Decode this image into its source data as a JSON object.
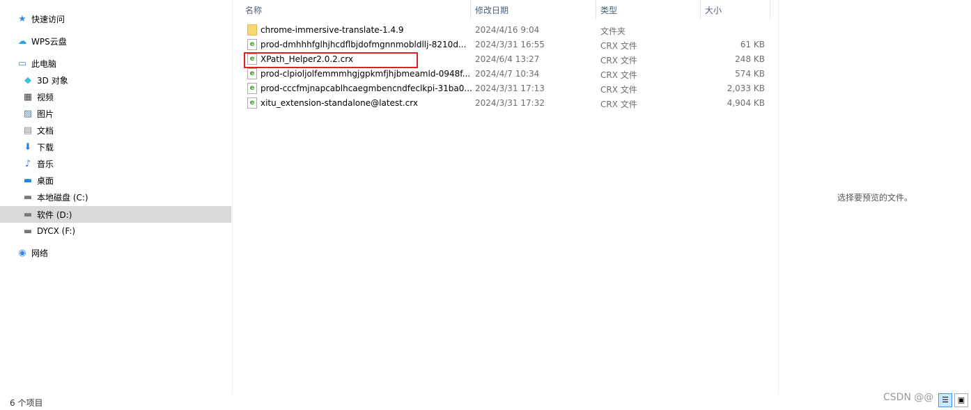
{
  "sidebar": {
    "items": [
      {
        "label": "快速访问",
        "icon": "star-icon"
      },
      {
        "label": "WPS云盘",
        "icon": "cloud-icon"
      },
      {
        "label": "此电脑",
        "icon": "computer-icon"
      },
      {
        "label": "3D 对象",
        "icon": "cube-icon"
      },
      {
        "label": "视频",
        "icon": "video-icon"
      },
      {
        "label": "图片",
        "icon": "picture-icon"
      },
      {
        "label": "文档",
        "icon": "document-icon"
      },
      {
        "label": "下载",
        "icon": "download-icon"
      },
      {
        "label": "音乐",
        "icon": "music-icon"
      },
      {
        "label": "桌面",
        "icon": "desktop-icon"
      },
      {
        "label": "本地磁盘 (C:)",
        "icon": "drive-icon"
      },
      {
        "label": "软件 (D:)",
        "icon": "drive-icon",
        "selected": true
      },
      {
        "label": "DYCX (F:)",
        "icon": "drive-icon"
      },
      {
        "label": "网络",
        "icon": "network-icon"
      }
    ]
  },
  "columns": {
    "name": "名称",
    "date": "修改日期",
    "type": "类型",
    "size": "大小",
    "sort_indicator": "^"
  },
  "files": [
    {
      "name": "chrome-immersive-translate-1.4.9",
      "date": "2024/4/16 9:04",
      "type": "文件夹",
      "size": "",
      "icon": "folder-icon"
    },
    {
      "name": "prod-dmhhhfglhjhcdflbjdofmgnnmobldllj-8210d...",
      "date": "2024/3/31 16:55",
      "type": "CRX 文件",
      "size": "61 KB",
      "icon": "crx-file-icon"
    },
    {
      "name": "XPath_Helper2.0.2.crx",
      "date": "2024/6/4 13:27",
      "type": "CRX 文件",
      "size": "248 KB",
      "icon": "crx-file-icon",
      "highlighted": true
    },
    {
      "name": "prod-clpioljolfemmmhgjgpkmfjhjbmeamld-0948f...",
      "date": "2024/4/7 10:34",
      "type": "CRX 文件",
      "size": "574 KB",
      "icon": "crx-file-icon"
    },
    {
      "name": "prod-cccfmjnapcablhcaegmbencndfeclkpi-31ba0...",
      "date": "2024/3/31 17:13",
      "type": "CRX 文件",
      "size": "2,033 KB",
      "icon": "crx-file-icon"
    },
    {
      "name": "xitu_extension-standalone@latest.crx",
      "date": "2024/3/31 17:32",
      "type": "CRX 文件",
      "size": "4,904 KB",
      "icon": "crx-file-icon"
    }
  ],
  "preview": {
    "message": "选择要预览的文件。"
  },
  "status": {
    "count": "6 个项目"
  },
  "watermark": "CSDN @@",
  "colors": {
    "highlight_box": "#e02020",
    "selected_nav": "#d9d9d9",
    "header_text": "#4c607a"
  }
}
